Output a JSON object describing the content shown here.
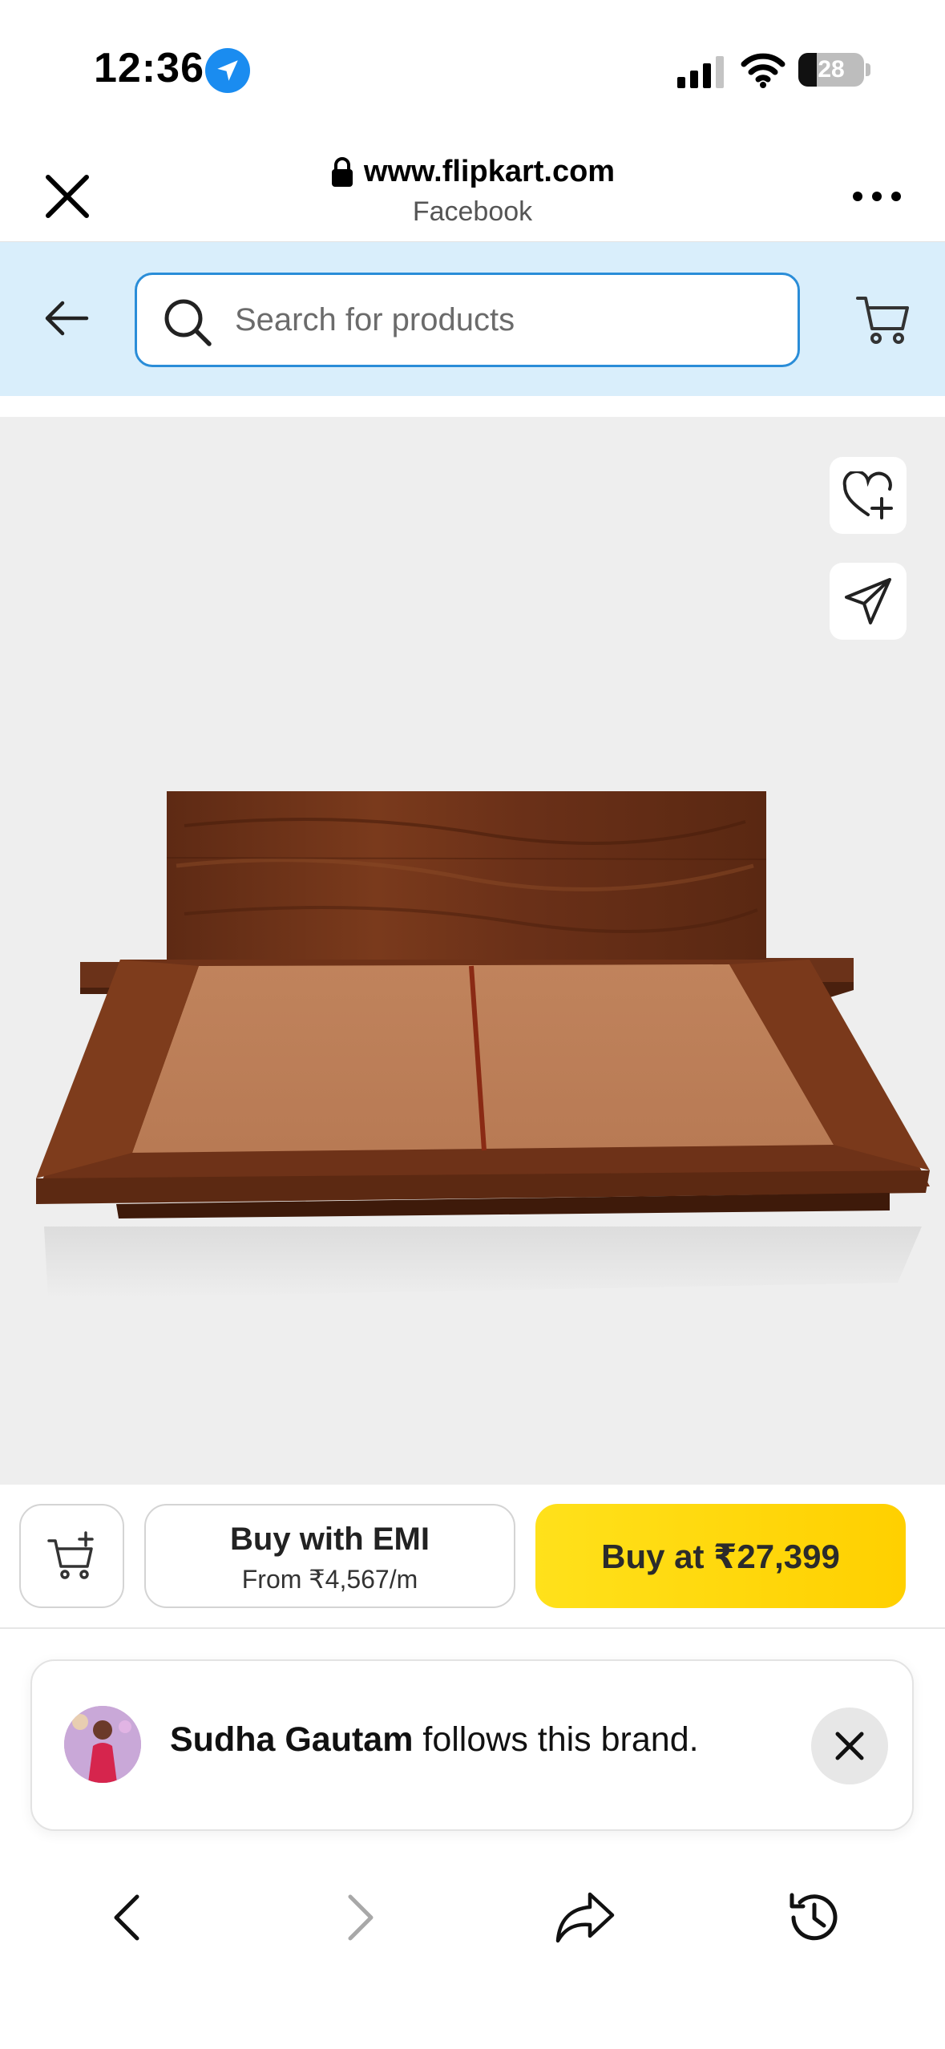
{
  "status_bar": {
    "time": "12:36",
    "battery_level": "28",
    "icons": [
      "location-icon",
      "signal-icon",
      "wifi-icon",
      "battery-icon"
    ]
  },
  "browser": {
    "url": "www.flipkart.com",
    "subtitle": "Facebook",
    "icons": [
      "close-icon",
      "lock-icon",
      "more-icon"
    ]
  },
  "search": {
    "placeholder": "Search for products",
    "accent_color": "#2a8dd8",
    "bar_background": "#d9eefb"
  },
  "product": {
    "image_description_icon": "wooden-platform-bed-image",
    "wishlist_icon": "heart-plus-icon",
    "share_icon": "share-icon"
  },
  "actions": {
    "add_to_cart_icon": "cart-plus-icon",
    "emi_title": "Buy with EMI",
    "emi_sub": "From ₹4,567/m",
    "buy_label": "Buy at ₹27,399",
    "buy_color": "#ffd600"
  },
  "toast": {
    "name": "Sudha Gautam",
    "message": " follows this brand."
  },
  "bottom_nav": {
    "icons": [
      "back-icon",
      "forward-icon",
      "share-arrow-icon",
      "history-icon"
    ]
  }
}
